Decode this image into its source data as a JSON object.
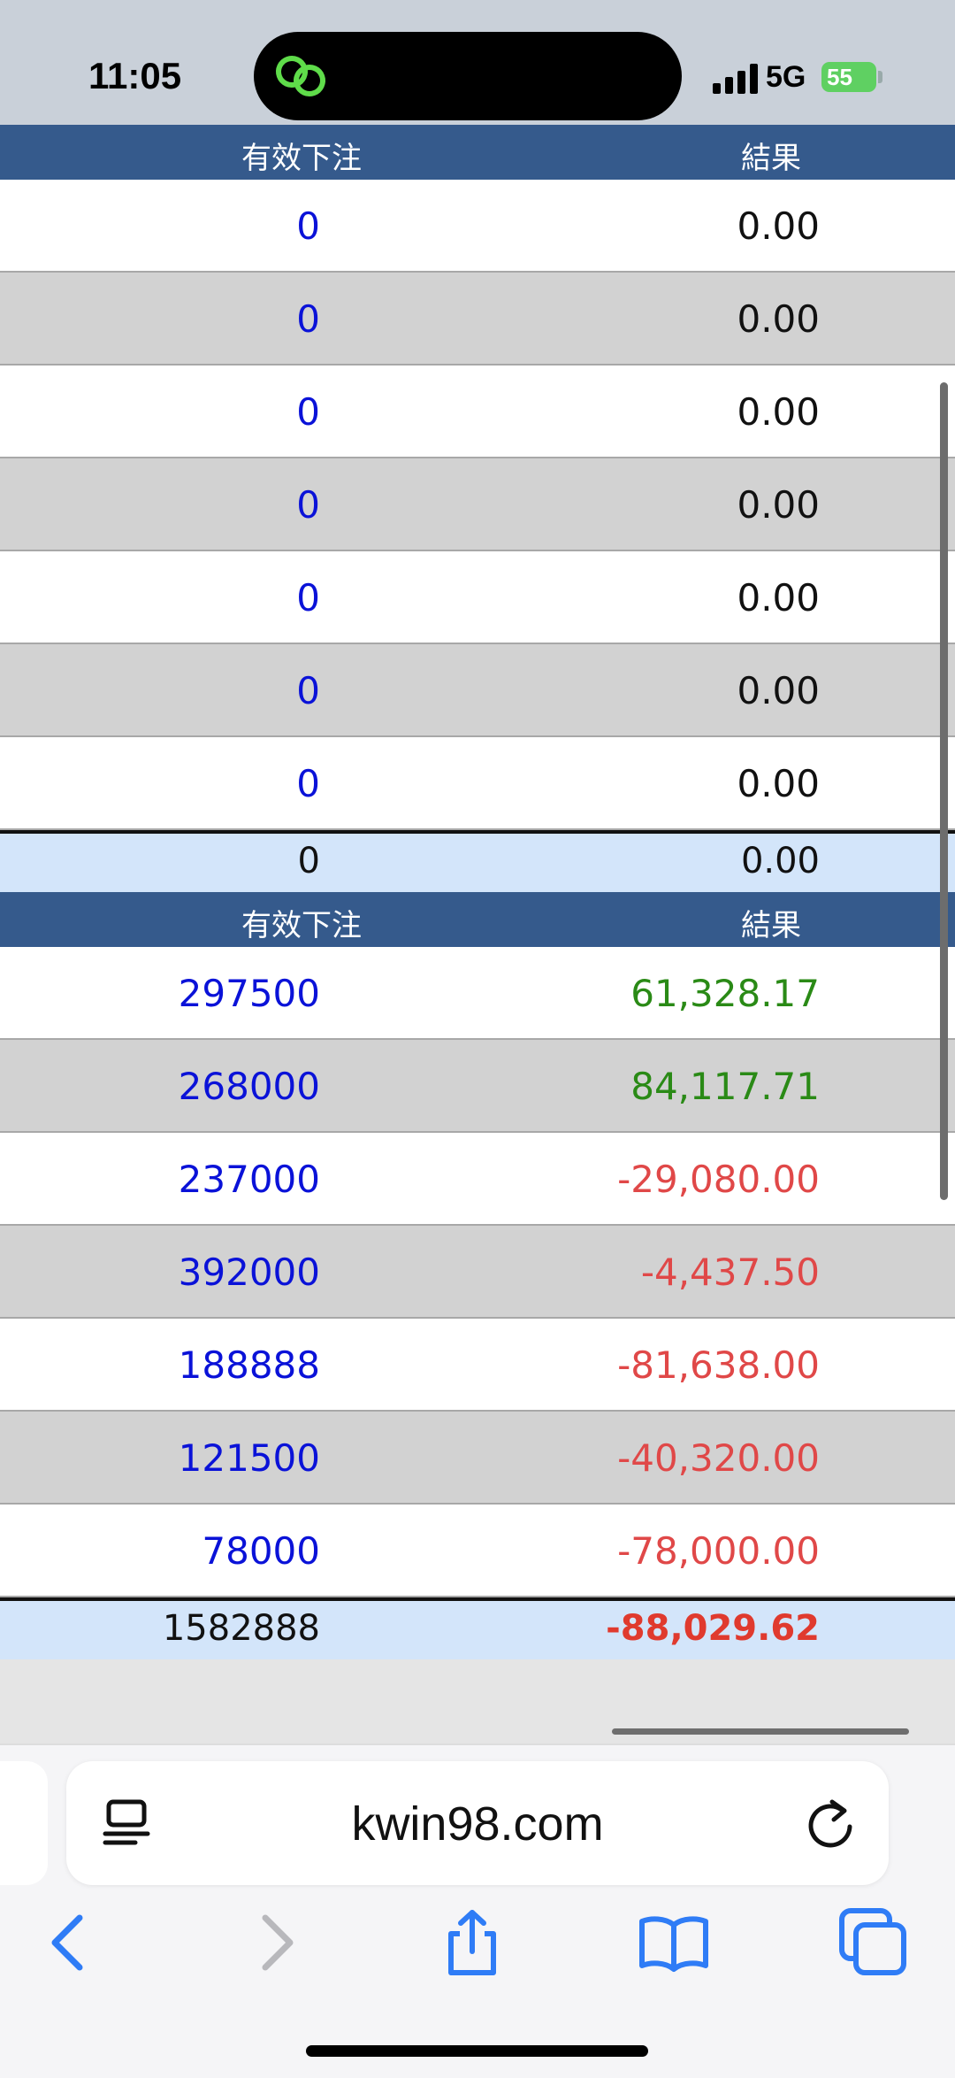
{
  "status_bar": {
    "time": "11:05",
    "network": "5G",
    "battery": "55"
  },
  "colors": {
    "header_bg": "#355a8c",
    "bet_blue": "#0a12d8",
    "positive_green": "#2a8a16",
    "negative_red": "#e04848",
    "total_bg": "#d3e5fa"
  },
  "section1": {
    "header": {
      "col_bet": "有效下注",
      "col_result": "結果"
    },
    "rows": [
      {
        "bet": "0",
        "result": "0.00",
        "sign": "zero"
      },
      {
        "bet": "0",
        "result": "0.00",
        "sign": "zero"
      },
      {
        "bet": "0",
        "result": "0.00",
        "sign": "zero"
      },
      {
        "bet": "0",
        "result": "0.00",
        "sign": "zero"
      },
      {
        "bet": "0",
        "result": "0.00",
        "sign": "zero"
      },
      {
        "bet": "0",
        "result": "0.00",
        "sign": "zero"
      },
      {
        "bet": "0",
        "result": "0.00",
        "sign": "zero"
      }
    ],
    "total": {
      "bet": "0",
      "result": "0.00"
    }
  },
  "section2": {
    "header": {
      "col_bet": "有效下注",
      "col_result": "結果"
    },
    "rows": [
      {
        "bet": "297500",
        "result": "61,328.17",
        "sign": "pos"
      },
      {
        "bet": "268000",
        "result": "84,117.71",
        "sign": "pos"
      },
      {
        "bet": "237000",
        "result": "-29,080.00",
        "sign": "neg"
      },
      {
        "bet": "392000",
        "result": "-4,437.50",
        "sign": "neg"
      },
      {
        "bet": "188888",
        "result": "-81,638.00",
        "sign": "neg"
      },
      {
        "bet": "121500",
        "result": "-40,320.00",
        "sign": "neg"
      },
      {
        "bet": "78000",
        "result": "-78,000.00",
        "sign": "neg"
      }
    ],
    "total": {
      "bet": "1582888",
      "result": "-88,029.62"
    }
  },
  "browser": {
    "url": "kwin98.com",
    "icons": [
      "reader-icon",
      "reload-icon",
      "back-icon",
      "forward-icon",
      "share-icon",
      "bookmarks-icon",
      "tabs-icon"
    ]
  }
}
